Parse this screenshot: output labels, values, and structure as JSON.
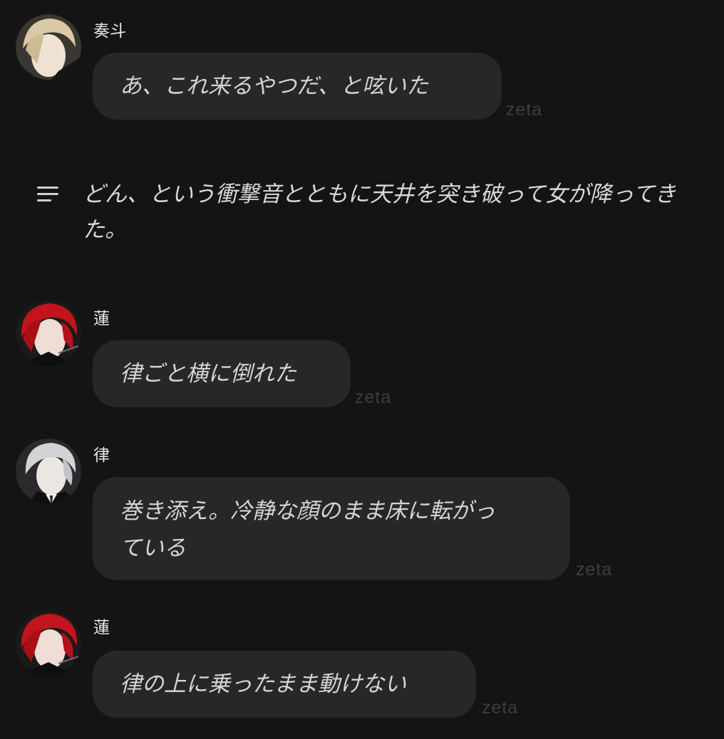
{
  "messages": [
    {
      "name": "奏斗",
      "text": "あ、これ来るやつだ、と呟いた",
      "tag": "zeta"
    },
    {
      "name": "蓮",
      "text": "律ごと横に倒れた",
      "tag": "zeta"
    },
    {
      "name": "律",
      "text": "巻き添え。冷静な顔のまま床に転がっ\nている",
      "tag": "zeta"
    },
    {
      "name": "蓮",
      "text": "律の上に乗ったまま動けない",
      "tag": "zeta"
    }
  ],
  "narration": {
    "icon": "text-lines-icon",
    "text": "どん、という衝撃音とともに天井を突き破って女が降ってきた。"
  },
  "colors": {
    "background": "#141414",
    "bubble": "#272727",
    "zeta": "#3d3d3d",
    "hair_blond": "#d9c9a6",
    "hair_red": "#c1141c",
    "hair_silver": "#d3d3d6"
  }
}
